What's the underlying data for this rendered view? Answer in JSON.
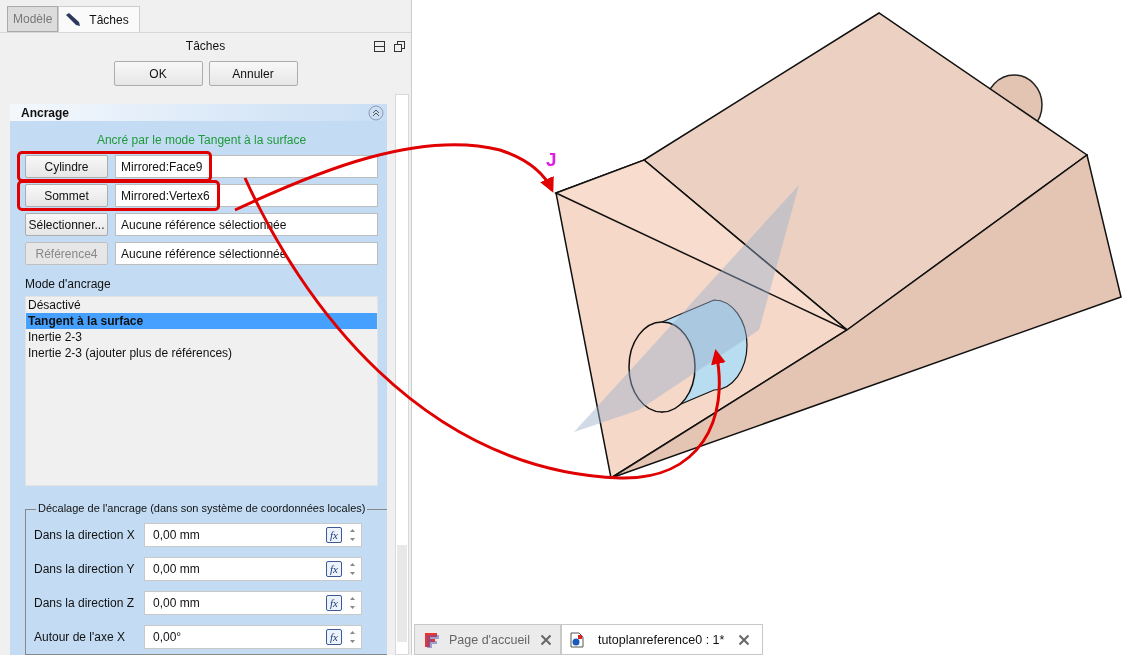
{
  "panel_tabs": [
    {
      "label": "Modèle",
      "selected": false
    },
    {
      "label": "Tâches",
      "selected": true
    }
  ],
  "task_title": "Tâches",
  "buttons": [
    "OK",
    "Annuler"
  ],
  "attachment": {
    "title": "Ancrage",
    "expanded": true,
    "status": "Ancré par le mode Tangent à la surface",
    "references": [
      {
        "button": "Cylindre",
        "value": "Mirrored:Face9",
        "disabled": false,
        "highlighted": true
      },
      {
        "button": "Sommet",
        "value": "Mirrored:Vertex6",
        "disabled": false,
        "highlighted": true
      },
      {
        "button": "Sélectionner...",
        "value": "Aucune référence sélectionnée",
        "disabled": false,
        "highlighted": false
      },
      {
        "button": "Référence4",
        "value": "Aucune référence sélectionnée",
        "disabled": true,
        "highlighted": false
      }
    ],
    "mode_label": "Mode d'ancrage",
    "modes": [
      {
        "label": "Désactivé",
        "selected": false
      },
      {
        "label": "Tangent à la surface",
        "selected": true
      },
      {
        "label": "Inertie 2-3",
        "selected": false
      },
      {
        "label": "Inertie 2-3 (ajouter plus de références)",
        "selected": false
      }
    ],
    "offset": {
      "title": "Décalage de l'ancrage (dans son système de coordonnées locales)",
      "fields": [
        {
          "label": "Dans la direction X",
          "value": "0,00 mm",
          "formula_button": "fx"
        },
        {
          "label": "Dans la direction Y",
          "value": "0,00 mm",
          "formula_button": "fx"
        },
        {
          "label": "Dans la direction Z",
          "value": "0,00 mm",
          "formula_button": "fx"
        },
        {
          "label": "Autour de l'axe X",
          "value": "0,00°",
          "formula_button": "fx"
        }
      ]
    }
  },
  "annotation": {
    "label": "J"
  },
  "document_tabs": [
    {
      "label": "Page d'accueil",
      "selected": false
    },
    {
      "label": "tutoplanreference0 : 1*",
      "selected": true
    }
  ]
}
